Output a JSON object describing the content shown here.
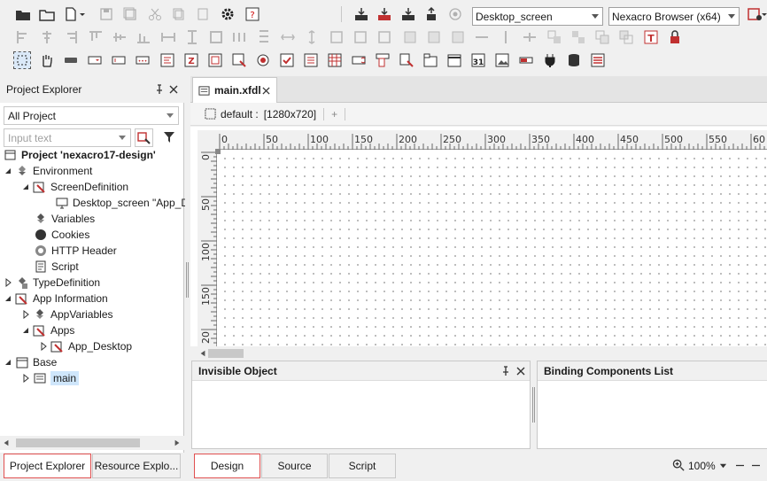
{
  "toolbar": {
    "screen_combo": "Desktop_screen",
    "browser_combo": "Nexacro Browser (x64)"
  },
  "project_explorer": {
    "title": "Project Explorer",
    "filter_combo": "All Project",
    "search_placeholder": "Input text",
    "tree": [
      {
        "label": "Project 'nexacro17-design'",
        "bold": true
      },
      {
        "label": "Environment"
      },
      {
        "label": "ScreenDefinition"
      },
      {
        "label": "Desktop_screen \"App_D"
      },
      {
        "label": "Variables"
      },
      {
        "label": "Cookies"
      },
      {
        "label": "HTTP Header"
      },
      {
        "label": "Script"
      },
      {
        "label": "TypeDefinition"
      },
      {
        "label": "App Information"
      },
      {
        "label": "AppVariables"
      },
      {
        "label": "Apps"
      },
      {
        "label": "App_Desktop"
      },
      {
        "label": "Base"
      },
      {
        "label": "main"
      }
    ],
    "bottom_tabs": [
      "Project Explorer",
      "Resource Explo..."
    ]
  },
  "editor": {
    "tab_label": "main.xfdl",
    "screen_label": "default :",
    "screen_size": "[1280x720]",
    "add_label": "+",
    "ruler_top": [
      "0",
      "50",
      "100",
      "150",
      "200",
      "250",
      "300",
      "350",
      "400",
      "450",
      "500",
      "550",
      "60"
    ],
    "ruler_left": [
      "0",
      "50",
      "100",
      "150",
      "20"
    ]
  },
  "panels": {
    "invisible_title": "Invisible Object",
    "binding_title": "Binding Components List"
  },
  "view_tabs": [
    "Design",
    "Source",
    "Script"
  ],
  "zoom": "100%",
  "colors": {
    "accent": "#e05050",
    "selected": "#cfe6fb"
  }
}
